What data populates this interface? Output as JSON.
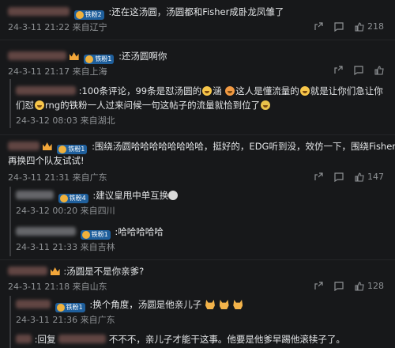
{
  "comments": [
    {
      "badge": "铁粉2",
      "text": ":还在这汤圆，汤圆都和Fisher成卧龙凤雏了",
      "time": "24-3-11 21:22",
      "location": "来自辽宁",
      "likes": "218"
    },
    {
      "badge": "铁粉1",
      "text": ":还汤圆啊你",
      "time": "24-3-11 21:17",
      "location": "来自上海",
      "likes": ""
    },
    {
      "reply_text_1a": ":100条评论，99条是怼汤圆的",
      "reply_text_1b": "涵",
      "reply_text_1c": "这人是懂流量的",
      "reply_text_1d": "就是让你们急让你",
      "reply_text_2a": "们怼",
      "reply_text_2b": "rng的铁粉一人过来问候一句这帖子的流量就恰到位了",
      "time": "24-3-12 08:03",
      "location": "来自湖北"
    },
    {
      "badge": "铁粉1",
      "text_1": ":围绕汤圆哈哈哈哈哈哈哈哈，挺好的，EDG听到没，效仿一下，围绕Fisher",
      "text_2": "再换四个队友试试!",
      "time": "24-3-11 21:31",
      "location": "来自广东",
      "likes": "147"
    },
    {
      "badge": "铁粉4",
      "text": ":建议皇甩中单互换",
      "time": "24-3-12 00:20",
      "location": "来自四川"
    },
    {
      "badge": "铁粉1",
      "text": ":哈哈哈哈哈",
      "time": "24-3-11 21:33",
      "location": "来自吉林"
    },
    {
      "text": ":汤圆是不是你亲爹?",
      "time": "24-3-11 21:18",
      "location": "来自山东",
      "likes": "128"
    },
    {
      "badge": "铁粉1",
      "text": ":换个角度，汤圆是他亲儿子",
      "time": "24-3-11 21:36",
      "location": "来自广东"
    },
    {
      "text_a": ":回复",
      "text_b": "不不不，亲儿子才能干这事。他要是他爹早踢他滚犊子了。"
    }
  ],
  "icons": [
    "share-icon",
    "comment-icon",
    "like-icon"
  ]
}
